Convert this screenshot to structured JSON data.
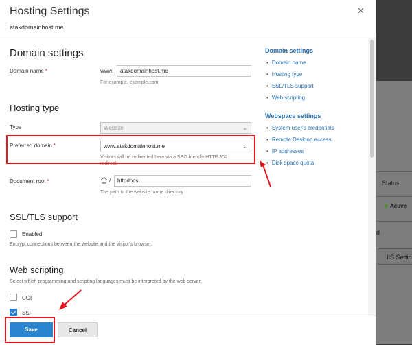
{
  "dialog": {
    "title": "Hosting Settings",
    "subtitle": "atakdomainhost.me",
    "close_icon": "close-icon"
  },
  "domain_settings": {
    "heading": "Domain settings",
    "domain_name_label": "Domain name",
    "required_mark": "*",
    "www_prefix": "www.",
    "domain_value": "atakdomainhost.me",
    "domain_hint": "For example, example.com"
  },
  "hosting_type": {
    "heading": "Hosting type",
    "type_label": "Type",
    "type_value": "Website",
    "preferred_label": "Preferred domain",
    "preferred_value": "www.atakdomainhost.me",
    "preferred_hint_1": "Visitors will be redirected here via a SEO friendly HTTP 301",
    "preferred_hint_2": "redirect.",
    "docroot_label": "Document root",
    "docroot_sep": "/",
    "docroot_value": "httpdocs",
    "docroot_hint": "The path to the website home directory"
  },
  "ssl": {
    "heading": "SSL/TLS support",
    "enabled_label": "Enabled",
    "enabled_checked": false,
    "description": "Encrypt connections between the website and the visitor's browser."
  },
  "scripting": {
    "heading": "Web scripting",
    "description": "Select which programming and scripting languages must be interpreted by the web server.",
    "cgi_label": "CGI",
    "cgi_checked": false,
    "ssi_label": "SSI",
    "ssi_checked": true
  },
  "nav": {
    "domain_heading": "Domain settings",
    "domain_items": [
      "Domain name",
      "Hosting type",
      "SSL/TLS support",
      "Web scripting"
    ],
    "webspace_heading": "Webspace settings",
    "webspace_items": [
      "System user's credentials",
      "Remote Desktop access",
      "IP addresses",
      "Disk space quota"
    ]
  },
  "footer": {
    "save_label": "Save",
    "cancel_label": "Cancel"
  },
  "background": {
    "status_label": "Status",
    "active_label": "Active",
    "d_label": "d",
    "iis_label": "IIS Setting"
  },
  "colors": {
    "accent": "#2a85cf",
    "link": "#2470b3",
    "highlight": "#e0181f"
  }
}
